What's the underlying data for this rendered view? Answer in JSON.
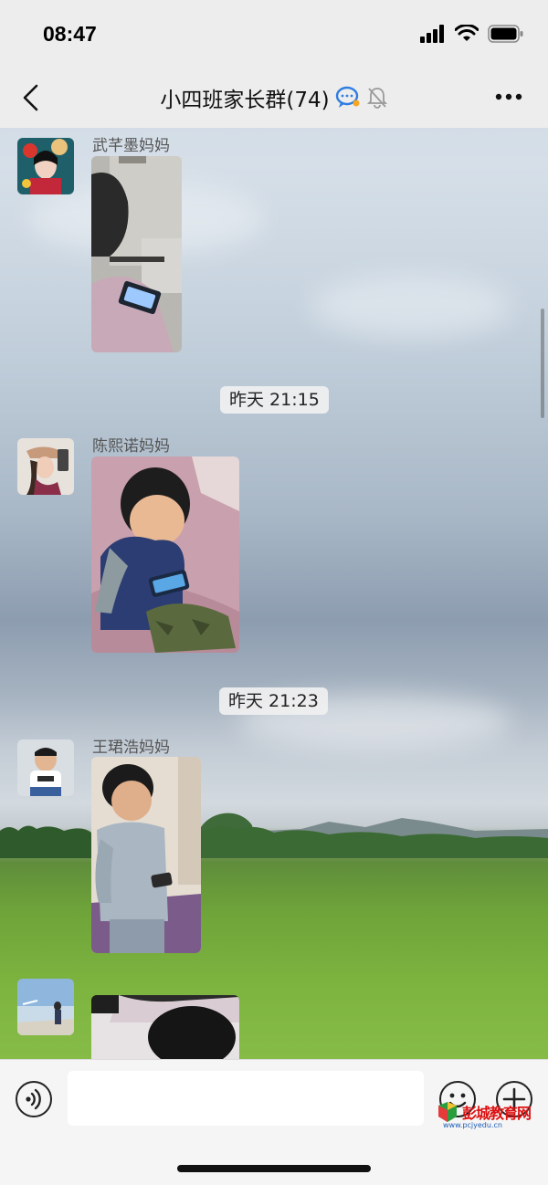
{
  "status_bar": {
    "time": "08:47"
  },
  "nav": {
    "title": "小四班家长群(74)",
    "back_icon": "chevron-left-icon",
    "more_icon": "ellipsis-icon"
  },
  "messages": [
    {
      "sender": "武芊墨妈妈",
      "type": "image",
      "content": "child-playing-phone-photo"
    },
    {
      "timestamp": "昨天 21:15"
    },
    {
      "sender": "陈熙诺妈妈",
      "type": "image",
      "content": "child-on-blanket-with-phone-photo"
    },
    {
      "timestamp": "昨天 21:23"
    },
    {
      "sender": "王珺浩妈妈",
      "type": "image",
      "content": "child-standing-with-phone-photo"
    },
    {
      "sender": "",
      "type": "image",
      "content": "child-in-bed-photo"
    }
  ],
  "input_bar": {
    "placeholder": "",
    "voice_icon": "voice-icon",
    "emoji_icon": "emoji-icon",
    "plus_icon": "plus-icon"
  },
  "watermark": {
    "text": "彭城教育网",
    "url": "www.pcjyedu.cn"
  },
  "colors": {
    "nav_background": "#ededed",
    "input_background": "#f5f5f5",
    "timestamp_background": "#f0f0f0"
  }
}
